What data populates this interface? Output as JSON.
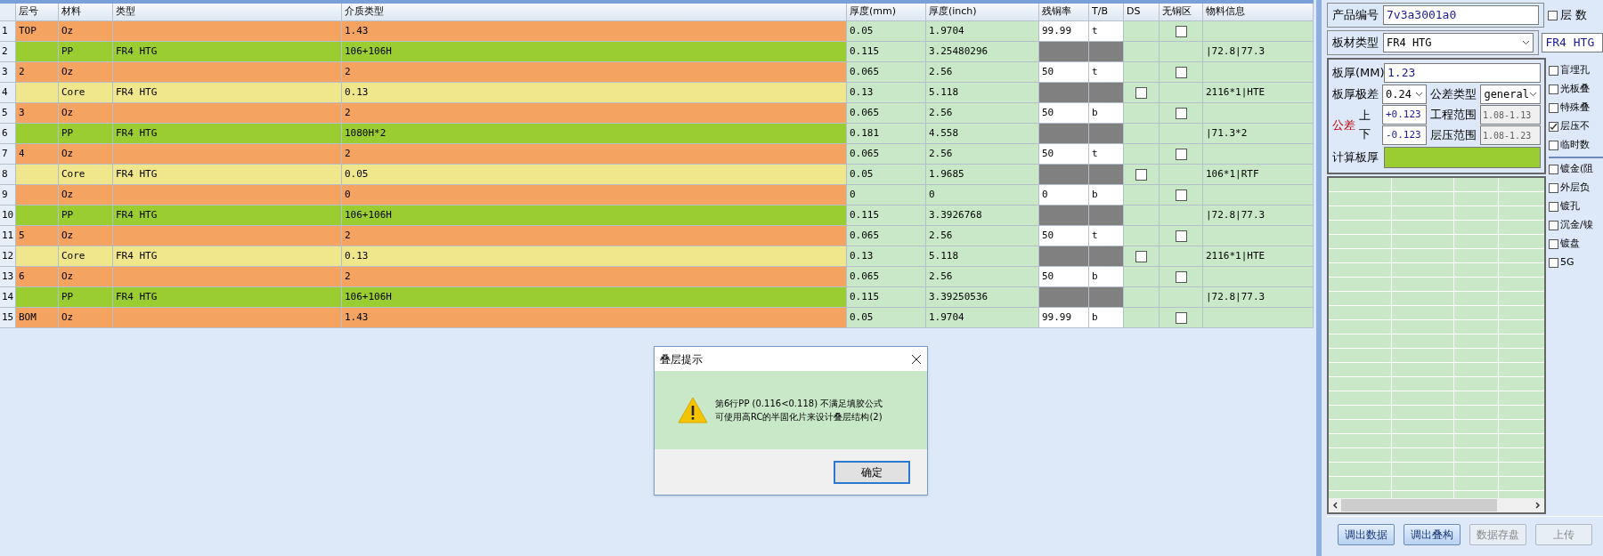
{
  "table": {
    "columns": [
      "层号",
      "材料",
      "类型",
      "介质类型",
      "厚度(mm)",
      "厚度(inch)",
      "残铜率",
      "T/B",
      "DS",
      "无铜区",
      "物料信息"
    ],
    "rows": [
      {
        "kind": "copper",
        "number": "1",
        "layer": "TOP",
        "material": "Oz",
        "type": "",
        "dielectric": "1.43",
        "thickness_mm": "0.05",
        "thickness_inch": "1.9704",
        "copper_ratio": "99.99",
        "tb": "t",
        "no_copper_checked": false,
        "info": ""
      },
      {
        "kind": "pp",
        "number": "2",
        "layer": "",
        "material": "PP",
        "type": "FR4 HTG",
        "dielectric": "106+106H",
        "thickness_mm": "0.115",
        "thickness_inch": "3.25480296",
        "info": "|72.8|77.3"
      },
      {
        "kind": "copper",
        "number": "3",
        "layer": "2",
        "material": "Oz",
        "type": "",
        "dielectric": "2",
        "thickness_mm": "0.065",
        "thickness_inch": "2.56",
        "copper_ratio": "50",
        "tb": "t",
        "no_copper_checked": false,
        "info": ""
      },
      {
        "kind": "core",
        "number": "4",
        "layer": "",
        "material": "Core",
        "type": "FR4 HTG",
        "dielectric": "0.13",
        "thickness_mm": "0.13",
        "thickness_inch": "5.118",
        "ds_checked": false,
        "info": "2116*1|HTE"
      },
      {
        "kind": "copper",
        "number": "5",
        "layer": "3",
        "material": "Oz",
        "type": "",
        "dielectric": "2",
        "thickness_mm": "0.065",
        "thickness_inch": "2.56",
        "copper_ratio": "50",
        "tb": "b",
        "no_copper_checked": false,
        "info": ""
      },
      {
        "kind": "pp",
        "number": "6",
        "layer": "",
        "material": "PP",
        "type": "FR4 HTG",
        "dielectric": "1080H*2",
        "thickness_mm": "0.181",
        "thickness_inch": "4.558",
        "info": "|71.3*2"
      },
      {
        "kind": "copper",
        "number": "7",
        "layer": "4",
        "material": "Oz",
        "type": "",
        "dielectric": "2",
        "thickness_mm": "0.065",
        "thickness_inch": "2.56",
        "copper_ratio": "50",
        "tb": "t",
        "no_copper_checked": false,
        "info": ""
      },
      {
        "kind": "core",
        "number": "8",
        "layer": "",
        "material": "Core",
        "type": "FR4 HTG",
        "dielectric": "0.05",
        "thickness_mm": "0.05",
        "thickness_inch": "1.9685",
        "ds_checked": false,
        "info": "106*1|RTF"
      },
      {
        "kind": "copper",
        "number": "9",
        "layer": "",
        "material": "Oz",
        "type": "",
        "dielectric": "0",
        "thickness_mm": "0",
        "thickness_inch": "0",
        "copper_ratio": "0",
        "tb": "b",
        "no_copper_checked": false,
        "info": ""
      },
      {
        "kind": "pp",
        "number": "10",
        "layer": "",
        "material": "PP",
        "type": "FR4 HTG",
        "dielectric": "106+106H",
        "thickness_mm": "0.115",
        "thickness_inch": "3.3926768",
        "info": "|72.8|77.3"
      },
      {
        "kind": "copper",
        "number": "11",
        "layer": "5",
        "material": "Oz",
        "type": "",
        "dielectric": "2",
        "thickness_mm": "0.065",
        "thickness_inch": "2.56",
        "copper_ratio": "50",
        "tb": "t",
        "no_copper_checked": false,
        "info": ""
      },
      {
        "kind": "core",
        "number": "12",
        "layer": "",
        "material": "Core",
        "type": "FR4 HTG",
        "dielectric": "0.13",
        "thickness_mm": "0.13",
        "thickness_inch": "5.118",
        "ds_checked": false,
        "info": "2116*1|HTE"
      },
      {
        "kind": "copper",
        "number": "13",
        "layer": "6",
        "material": "Oz",
        "type": "",
        "dielectric": "2",
        "thickness_mm": "0.065",
        "thickness_inch": "2.56",
        "copper_ratio": "50",
        "tb": "b",
        "no_copper_checked": false,
        "info": ""
      },
      {
        "kind": "pp",
        "number": "14",
        "layer": "",
        "material": "PP",
        "type": "FR4 HTG",
        "dielectric": "106+106H",
        "thickness_mm": "0.115",
        "thickness_inch": "3.39250536",
        "info": "|72.8|77.3"
      },
      {
        "kind": "copper",
        "number": "15",
        "layer": "BOM",
        "material": "Oz",
        "type": "",
        "dielectric": "1.43",
        "thickness_mm": "0.05",
        "thickness_inch": "1.9704",
        "copper_ratio": "99.99",
        "tb": "b",
        "no_copper_checked": false,
        "info": ""
      }
    ]
  },
  "side_panel": {
    "product_no": {
      "label": "产品编号",
      "value": "7v3a3001a0"
    },
    "layer_count": {
      "label": "层 数",
      "checked": false
    },
    "board_type": {
      "label": "板材类型",
      "value": "FR4 HTG",
      "value_2": "FR4 HTG"
    },
    "thickness": {
      "label": "板厚(MM)",
      "value": "1.23"
    },
    "thickness_range": {
      "label": "板厚极差",
      "value": "0.24"
    },
    "tolerance_type": {
      "label": "公差类型",
      "value": "general"
    },
    "tolerance": {
      "label": "公差",
      "upper_label": "上",
      "lower_label": "下",
      "upper": "+0.123",
      "lower": "-0.123"
    },
    "engineering_range": {
      "label": "工程范围",
      "value": "1.08-1.13"
    },
    "lamination_range": {
      "label": "层压范围",
      "value": "1.08-1.23"
    },
    "calculated_thickness": {
      "label": "计算板厚"
    },
    "options": [
      {
        "label": "盲埋孔",
        "checked": false
      },
      {
        "label": "光板叠",
        "checked": false
      },
      {
        "label": "特殊叠",
        "checked": false
      },
      {
        "label": "层压不",
        "checked": true
      },
      {
        "label": "临时数",
        "checked": false
      }
    ],
    "options_2": [
      {
        "label": "镀金(阻",
        "checked": false
      },
      {
        "label": "外层负",
        "checked": false
      },
      {
        "label": "镀孔",
        "checked": false
      },
      {
        "label": "沉金/镍",
        "checked": false
      },
      {
        "label": "镀盘",
        "checked": false
      },
      {
        "label": "5G",
        "checked": false
      }
    ],
    "buttons": [
      {
        "label": "调出数据",
        "disabled": false
      },
      {
        "label": "调出叠构",
        "disabled": false
      },
      {
        "label": "数据存盘",
        "disabled": true
      },
      {
        "label": "上传",
        "disabled": true
      }
    ]
  },
  "dialog": {
    "title": "叠层提示",
    "message_lines": [
      "第6行PP (0.116<0.118) 不满足填胶公式",
      "可使用高RC的半固化片来设计叠层结构(2)"
    ],
    "button": "确定"
  }
}
